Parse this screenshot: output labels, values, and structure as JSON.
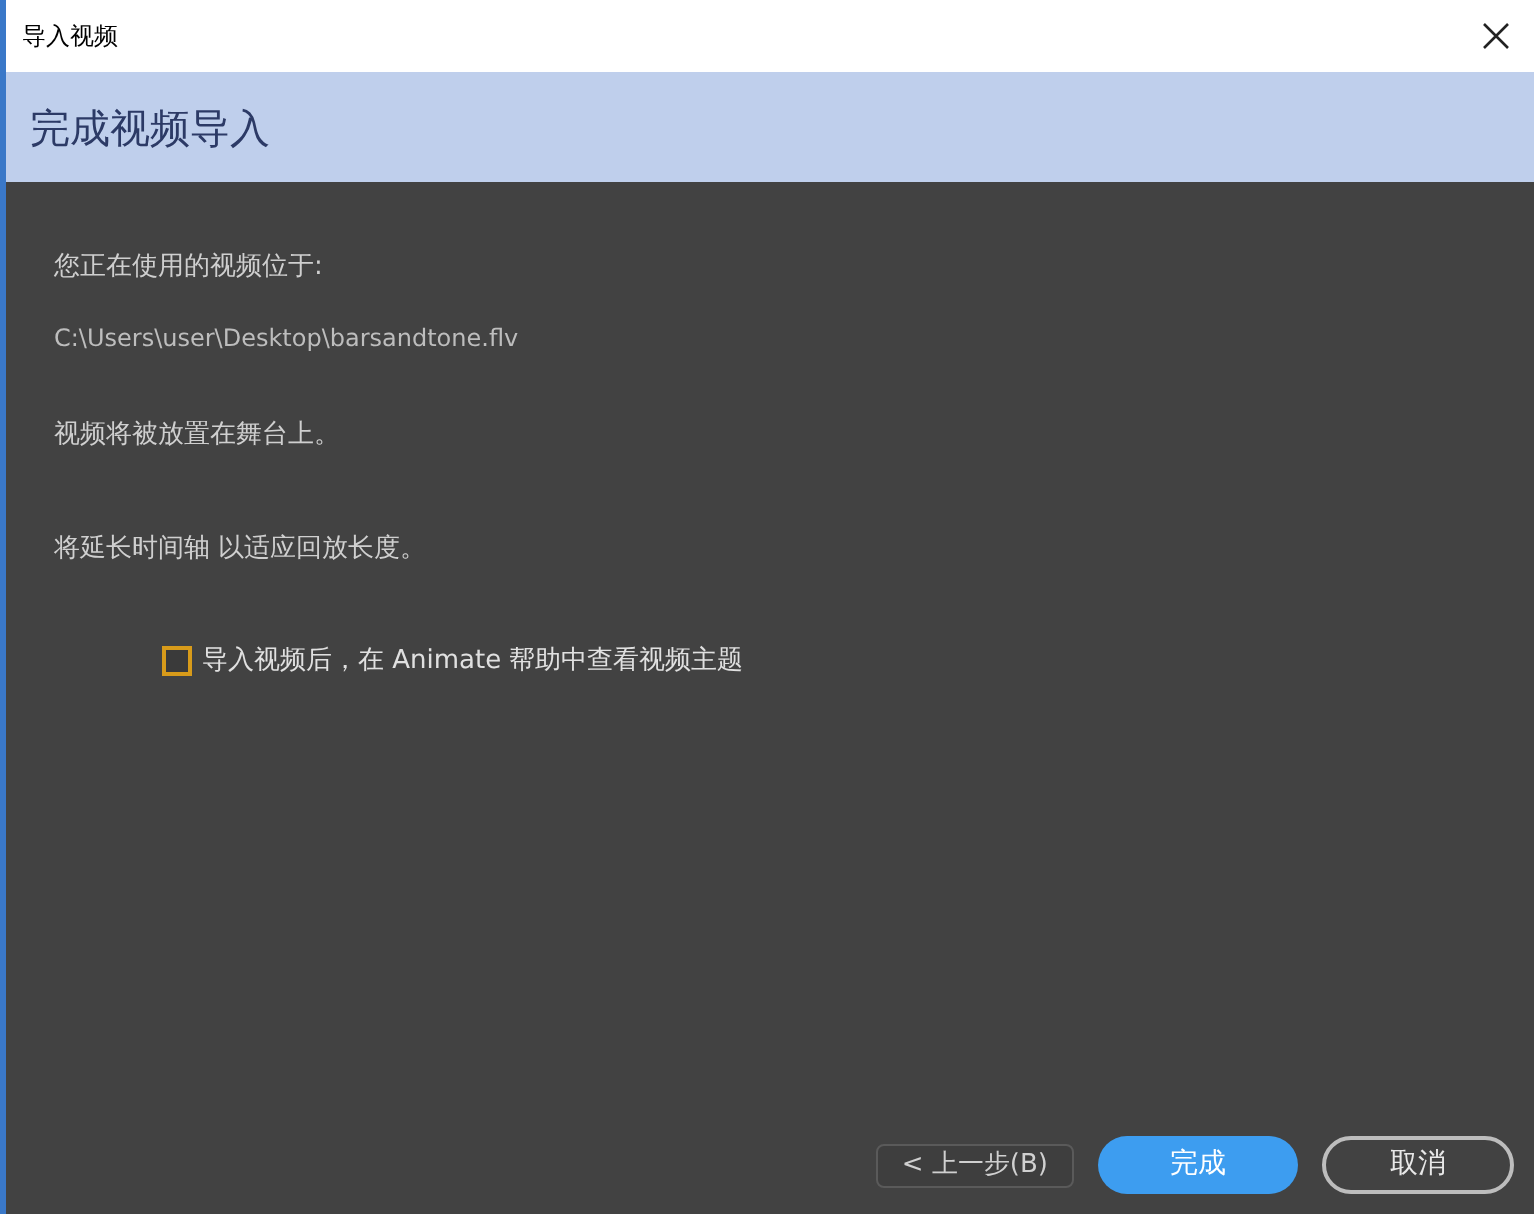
{
  "window": {
    "title": "导入视频"
  },
  "header": {
    "title": "完成视频导入"
  },
  "body": {
    "location_label": "您正在使用的视频位于:",
    "path": "C:\\Users\\user\\Desktop\\barsandtone.flv",
    "stage_note": "视频将被放置在舞台上。",
    "timeline_note": "将延长时间轴 以适应回放长度。"
  },
  "help_checkbox": {
    "label": "导入视频后，在 Animate 帮助中查看视频主题",
    "checked": false
  },
  "buttons": [
    {
      "label": "< 上一步(B)",
      "kind": "back"
    },
    {
      "label": "完成",
      "kind": "primary"
    },
    {
      "label": "取消",
      "kind": "outline"
    }
  ]
}
